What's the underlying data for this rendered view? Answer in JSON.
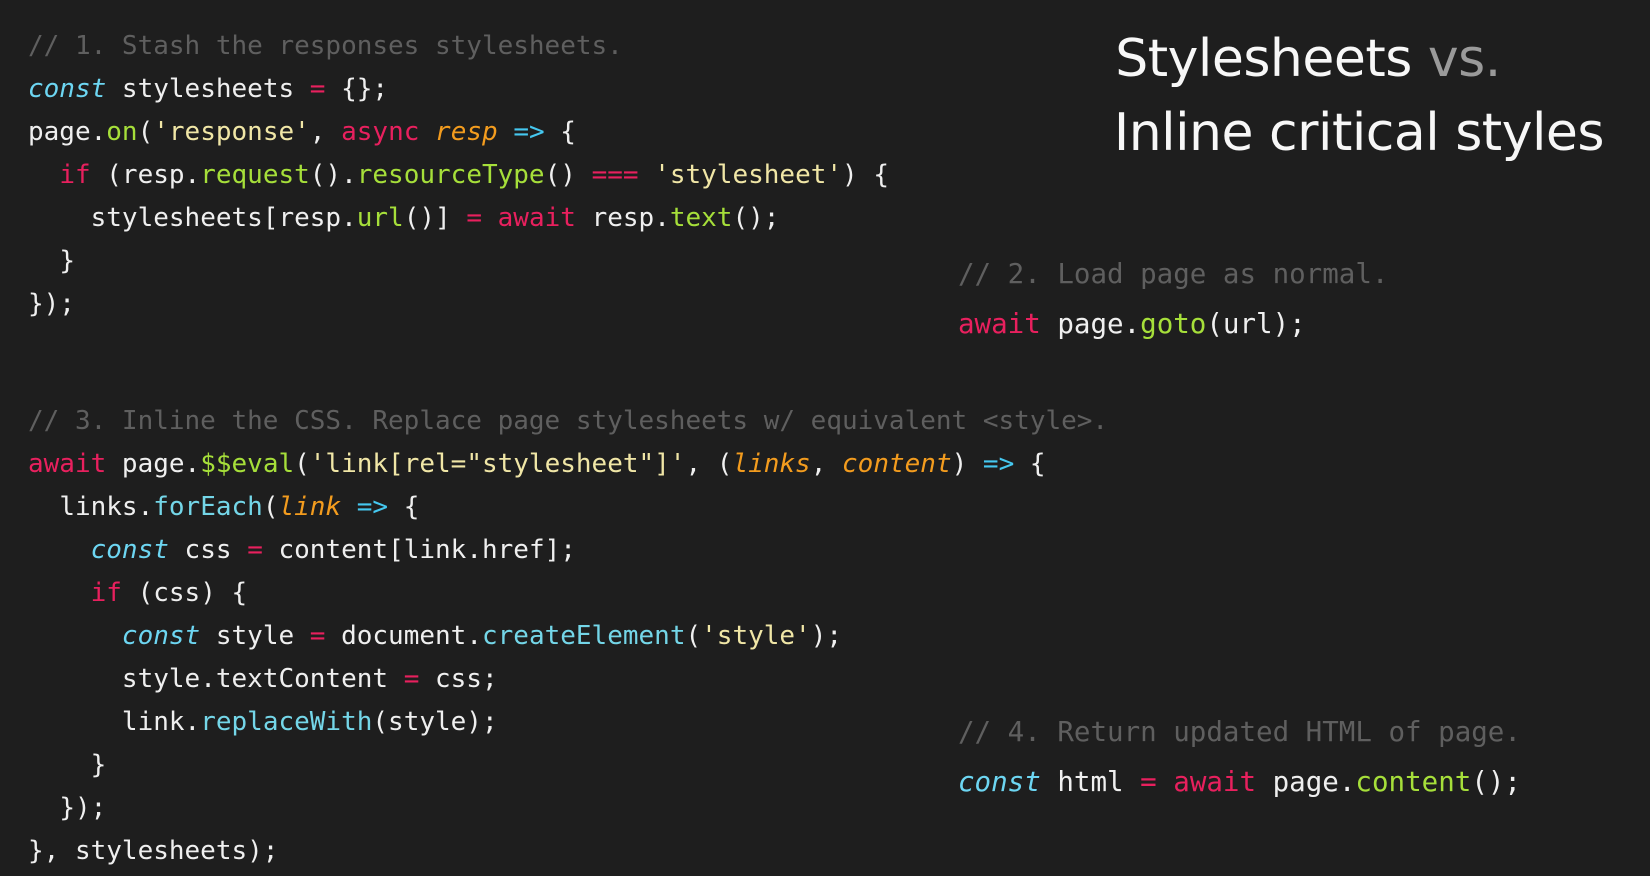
{
  "title": {
    "line1_main": "Stylesheets",
    "line1_muted": "vs.",
    "line2": "Inline critical styles"
  },
  "step1": {
    "comment": "// 1. Stash the responses stylesheets.",
    "const_kw": "const",
    "decl_name": " stylesheets ",
    "decl_eq": "=",
    "decl_rest": " {};",
    "on_prefix": "page.",
    "on_fn": "on",
    "on_open": "(",
    "on_event": "'response'",
    "on_comma": ", ",
    "async_kw": "async",
    "resp_param": "resp",
    "arrow": "=>",
    "on_brace": " {",
    "if_kw": "if",
    "if_open": " (resp.",
    "request_fn": "request",
    "if_mid": "().",
    "resourcetype_fn": "resourceType",
    "if_call": "() ",
    "strict_eq": "===",
    "stylesheet_str": "'stylesheet'",
    "if_close": ") {",
    "assign_prefix": "stylesheets[resp.",
    "url_fn": "url",
    "assign_mid": "()] ",
    "assign_eq": "=",
    "await_kw": "await",
    "assign_resp": " resp.",
    "text_fn": "text",
    "assign_end": "();",
    "close_brace": "}",
    "close_all": "});"
  },
  "step2": {
    "comment": "// 2. Load page as normal.",
    "await_kw": "await",
    "page_prefix": " page.",
    "goto_fn": "goto",
    "goto_args": "(url);"
  },
  "step3": {
    "comment": "// 3. Inline the CSS. Replace page stylesheets w/ equivalent <style>.",
    "await_kw": "await",
    "page_prefix": " page.",
    "eval_fn": "$$eval",
    "eval_open": "(",
    "selector_str": "'link[rel=\"stylesheet\"]'",
    "eval_comma": ", (",
    "links_param": "links",
    "param_sep": ", ",
    "content_param": "content",
    "params_close": ") ",
    "arrow": "=>",
    "brace": " {",
    "links_prefix": "links.",
    "foreach_fn": "forEach",
    "foreach_open": "(",
    "link_param": "link",
    "const_kw": "const",
    "css_decl": " css ",
    "eq": "=",
    "css_rest": " content[link.href];",
    "if_kw": "if",
    "if_rest": " (css) {",
    "style_decl": " style ",
    "doc_prefix": " document.",
    "create_fn": "createElement",
    "create_open": "(",
    "style_str": "'style'",
    "create_close": ");",
    "textcontent_prefix": "style.textContent ",
    "textcontent_rest": " css;",
    "replace_prefix": "link.",
    "replace_fn": "replaceWith",
    "replace_args": "(style);",
    "inner_close": "}",
    "foreach_close": "});",
    "final_close": "}, stylesheets);"
  },
  "step4": {
    "comment": "// 4. Return updated HTML of page.",
    "const_kw": "const",
    "html_decl": " html ",
    "eq": "=",
    "await_kw": "await",
    "page_prefix": " page.",
    "content_fn": "content",
    "content_args": "();"
  }
}
